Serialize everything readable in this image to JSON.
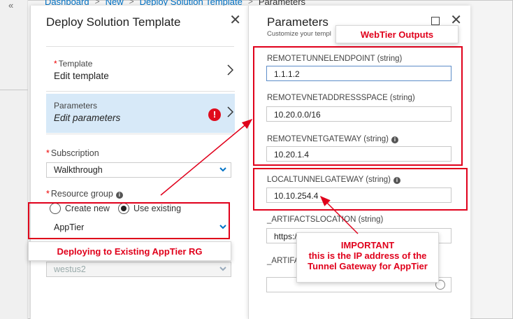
{
  "breadcrumb": {
    "items": [
      "Dashboard",
      "New",
      "Deploy Solution Template"
    ],
    "current": "Parameters",
    "sep": ">"
  },
  "rail": {
    "collapse": "«"
  },
  "blade1": {
    "title": "Deploy Solution Template",
    "close": "✕",
    "template": {
      "required": "*",
      "label": "Template",
      "value": "Edit template"
    },
    "parameters": {
      "label": "Parameters",
      "value": "Edit parameters",
      "error": "!"
    },
    "subscription": {
      "required": "*",
      "label": "Subscription",
      "value": "Walkthrough"
    },
    "resource_group": {
      "required": "*",
      "label": "Resource group",
      "info": "i",
      "options": [
        "Create new",
        "Use existing"
      ],
      "selected": "Use existing",
      "value": "AppTier"
    },
    "location": {
      "value": "westus2"
    }
  },
  "callouts": {
    "deploying": "Deploying to Existing AppTier RG",
    "webtier": "WebTier Outputs",
    "important_title": "IMPORTANT",
    "important_line1": "this is the IP address of the",
    "important_line2": "Tunnel Gateway for AppTier"
  },
  "blade2": {
    "title": "Parameters",
    "subtitle": "Customize your templ",
    "close": "✕",
    "params": [
      {
        "label": "REMOTETUNNELENDPOINT (string)",
        "value": "1.1.1.2"
      },
      {
        "label": "REMOTEVNETADDRESSSPACE (string)",
        "value": "10.20.0.0/16"
      },
      {
        "label": "REMOTEVNETGATEWAY (string)",
        "info": "i",
        "value": "10.20.1.4"
      },
      {
        "label": "LOCALTUNNELGATEWAY (string)",
        "info": "i",
        "value": "10.10.254.4"
      },
      {
        "label": "_ARTIFACTSLOCATION (string)",
        "value": "https:/"
      },
      {
        "label": "_ARTIFAC",
        "value": ""
      }
    ]
  },
  "colors": {
    "accent": "#0072c6",
    "annotation": "#e0001b",
    "selected": "#d7e9f8"
  }
}
